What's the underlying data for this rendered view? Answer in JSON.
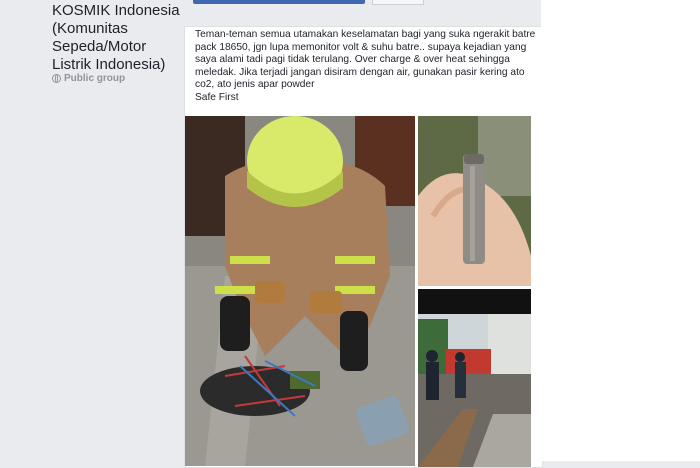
{
  "group": {
    "name": "KOSMIK Indonesia (Komunitas Sepeda/Motor Listrik Indonesia)",
    "type": "Public group"
  },
  "post": {
    "text": "Teman-teman semua utamakan keselamatan bagi yang suka ngerakit batre pack 18650, jgn lupa memonitor volt & suhu batre.. supaya kejadian yang saya alami tadi pagi tidak terulang. Over charge & over heat sehingga meledak. Jika terjadi jangan disiram dengan air, gunakan pasir kering ato co2, ato jenis apar powder\nSafe First"
  },
  "icons": [
    "globe-icon"
  ]
}
